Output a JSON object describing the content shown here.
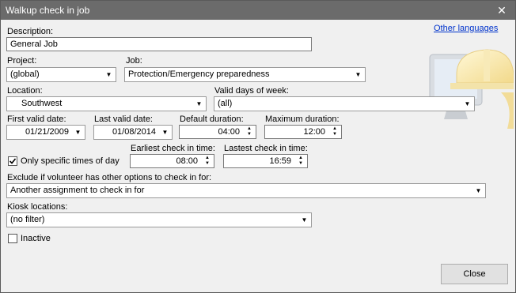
{
  "window": {
    "title": "Walkup check in job",
    "close_glyph": "✕"
  },
  "other_languages_link": "Other languages",
  "description": {
    "label": "Description:",
    "value": "General Job"
  },
  "project": {
    "label": "Project:",
    "value": "(global)"
  },
  "job": {
    "label": "Job:",
    "value": "Protection/Emergency preparedness"
  },
  "location": {
    "label": "Location:",
    "value": "Southwest"
  },
  "valid_days": {
    "label": "Valid days of week:",
    "value": "(all)"
  },
  "first_valid_date": {
    "label": "First valid date:",
    "value": "01/21/2009"
  },
  "last_valid_date": {
    "label": "Last valid date:",
    "value": "01/08/2014"
  },
  "default_duration": {
    "label": "Default duration:",
    "value": "04:00"
  },
  "maximum_duration": {
    "label": "Maximum duration:",
    "value": "12:00"
  },
  "only_specific_times": {
    "label": "Only specific times of day",
    "checked": true
  },
  "earliest_check_in": {
    "label": "Earliest check in time:",
    "value": "08:00"
  },
  "latest_check_in": {
    "label": "Lastest check in time:",
    "value": "16:59"
  },
  "exclude": {
    "label": "Exclude if volunteer has other options to check in for:",
    "value": "Another assignment to check in for"
  },
  "kiosk_locations": {
    "label": "Kiosk locations:",
    "value": "(no filter)"
  },
  "inactive": {
    "label": "Inactive",
    "checked": false
  },
  "close_button": "Close",
  "icons": {
    "dropdown": "chevron-down-icon",
    "spin": "spin-arrows-icon",
    "decor": "hardhat-monitor-icon"
  }
}
